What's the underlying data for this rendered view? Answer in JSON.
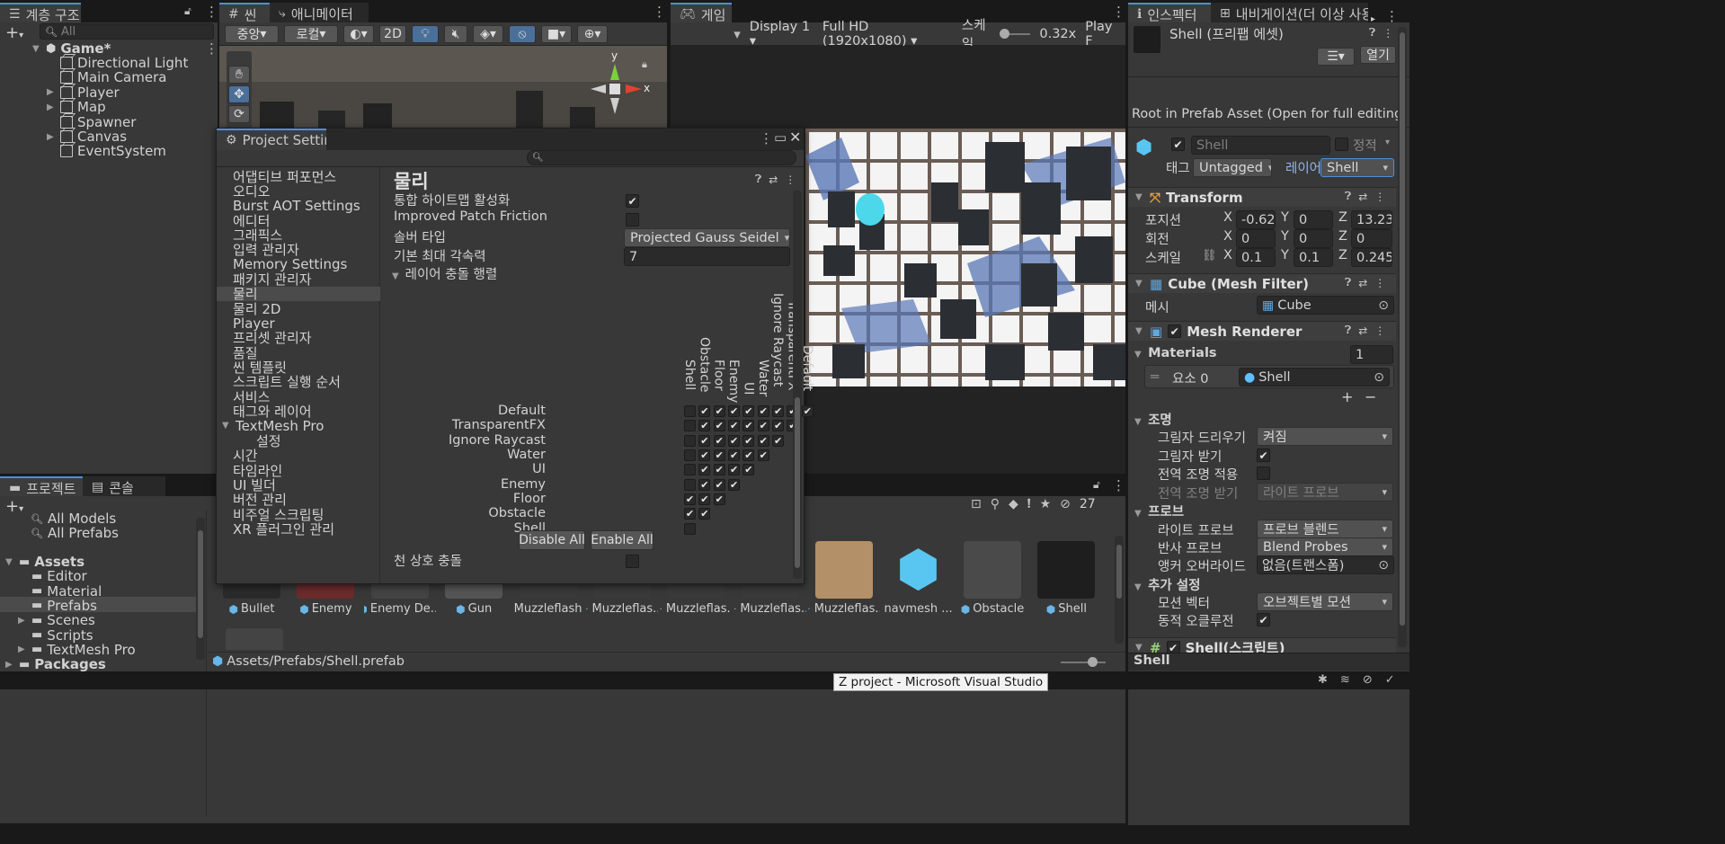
{
  "hierarchy": {
    "tab": "계층 구조",
    "search_placeholder": "All",
    "scene": "Game*",
    "items": [
      {
        "label": "Directional Light",
        "expandable": false
      },
      {
        "label": "Main Camera",
        "expandable": false
      },
      {
        "label": "Player",
        "expandable": true
      },
      {
        "label": "Map",
        "expandable": true
      },
      {
        "label": "Spawner",
        "expandable": false
      },
      {
        "label": "Canvas",
        "expandable": true
      },
      {
        "label": "EventSystem",
        "expandable": false
      }
    ]
  },
  "scene_tabs": {
    "scene": "씬",
    "animator": "애니메이터",
    "game": "게임"
  },
  "scene_toolbar": {
    "pivot": "중앙",
    "space": "로컬",
    "mode_2d": "2D"
  },
  "game_toolbar": {
    "display": "Display 1",
    "resolution": "Full HD (1920x1080)",
    "scale_label": "스케일",
    "scale_value": "0.32x",
    "play": "Play F"
  },
  "project_settings": {
    "title": "Project Settings",
    "categories": [
      "어댑티브 퍼포먼스",
      "오디오",
      "Burst AOT Settings",
      "에디터",
      "그래픽스",
      "입력 관리자",
      "Memory Settings",
      "패키지 관리자",
      "물리",
      "물리 2D",
      "Player",
      "프리셋 관리자",
      "품질",
      "씬 템플릿",
      "스크립트 실행 순서",
      "서비스",
      "태그와 레이어",
      "TextMesh Pro",
      "설정",
      "시간",
      "타임라인",
      "UI 빌더",
      "버전 관리",
      "비주얼 스크립팅",
      "XR 플러그인 관리"
    ],
    "selected": "물리",
    "section_title": "물리",
    "props": [
      {
        "label": "통합 하이트맵 활성화",
        "checked": true
      },
      {
        "label": "Improved Patch Friction",
        "checked": false
      }
    ],
    "solver_label": "솔버 타입",
    "solver_value": "Projected Gauss Seidel",
    "angvel_label": "기본 최대 각속력",
    "angvel_value": "7",
    "matrix_label": "레이어 충돌 행렬",
    "layers": [
      "Default",
      "TransparentFX",
      "Ignore Raycast",
      "Water",
      "UI",
      "Enemy",
      "Floor",
      "Obstacle",
      "Shell"
    ],
    "matrix": [
      [
        false,
        true,
        true,
        true,
        true,
        true,
        true,
        true,
        true
      ],
      [
        false,
        true,
        true,
        true,
        true,
        true,
        true,
        true
      ],
      [
        false,
        true,
        true,
        true,
        true,
        true,
        true
      ],
      [
        false,
        true,
        true,
        true,
        true,
        true
      ],
      [
        false,
        true,
        true,
        true,
        true
      ],
      [
        false,
        true,
        true,
        true
      ],
      [
        true,
        true,
        true
      ],
      [
        true,
        true
      ],
      [
        false
      ]
    ],
    "disable_all": "Disable All",
    "enable_all": "Enable All",
    "cloth_label": "천 상호 충돌",
    "cloth_checked": false
  },
  "project": {
    "tab_project": "프로젝트",
    "tab_console": "콘솔",
    "favorites": [
      "All Models",
      "All Prefabs"
    ],
    "folders": [
      {
        "label": "Assets",
        "level": 0,
        "open": true
      },
      {
        "label": "Editor",
        "level": 1
      },
      {
        "label": "Material",
        "level": 1
      },
      {
        "label": "Prefabs",
        "level": 1,
        "selected": true
      },
      {
        "label": "Scenes",
        "level": 1,
        "expandable": true
      },
      {
        "label": "Scripts",
        "level": 1
      },
      {
        "label": "TextMesh Pro",
        "level": 1,
        "expandable": true
      },
      {
        "label": "Packages",
        "level": 0,
        "expandable": true
      }
    ],
    "hidden_count": "27",
    "assets": [
      "Bullet",
      "Enemy",
      "Enemy De...",
      "Gun",
      "Muzzleflash",
      "Muzzleflas...",
      "Muzzleflas...",
      "Muzzleflas...",
      "Muzzleflas...",
      "navmesh ...",
      "Obstacle",
      "Shell"
    ],
    "path": "Assets/Prefabs/Shell.prefab"
  },
  "inspector": {
    "tab_inspector": "인스펙터",
    "tab_nav": "내비게이션(더 이상 사용...",
    "asset_title": "Shell (프리팹 에셋)",
    "open_btn": "열기",
    "root_note": "Root in Prefab Asset (Open for full editing suppo",
    "name": "Shell",
    "static_label": "정적",
    "tag_label": "태그",
    "tag_value": "Untagged",
    "layer_label": "레이어",
    "layer_value": "Shell",
    "transform": {
      "title": "Transform",
      "position_label": "포지션",
      "rotation_label": "회전",
      "scale_label": "스케일",
      "position": [
        "-0.622",
        "0",
        "13.23("
      ],
      "rotation": [
        "0",
        "0",
        "0"
      ],
      "scale": [
        "0.1",
        "0.1",
        "0.245:"
      ]
    },
    "mesh_filter": {
      "title": "Cube (Mesh Filter)",
      "mesh_label": "메시",
      "mesh_value": "Cube"
    },
    "mesh_renderer": {
      "title": "Mesh Renderer",
      "materials_label": "Materials",
      "materials_count": "1",
      "element_label": "요소 0",
      "element_value": "Shell"
    },
    "lighting": {
      "title": "조명",
      "cast_shadows_label": "그림자 드리우기",
      "cast_shadows_value": "켜짐",
      "receive_shadows_label": "그림자 받기",
      "gi_label": "전역 조명 적용",
      "receive_gi_label": "전역 조명 받기",
      "receive_gi_value": "라이트 프로브"
    },
    "probes": {
      "title": "프로브",
      "light_probe_label": "라이트 프로브",
      "light_probe_value": "프로브 블렌드",
      "reflection_label": "반사 프로브",
      "reflection_value": "Blend Probes",
      "anchor_label": "앵커 오버라이드",
      "anchor_value": "없음(트랜스폼)"
    },
    "additional": {
      "title": "추가 설정",
      "motion_label": "모션 벡터",
      "motion_value": "오브젝트별 모션",
      "dynamic_occlusion_label": "동적 오클루전"
    },
    "script_title": "Shell(스크립트)",
    "footer": "Shell"
  },
  "statusbar": {
    "tooltip": "Z project - Microsoft Visual Studio"
  },
  "axes": {
    "x": "x",
    "y": "y"
  }
}
